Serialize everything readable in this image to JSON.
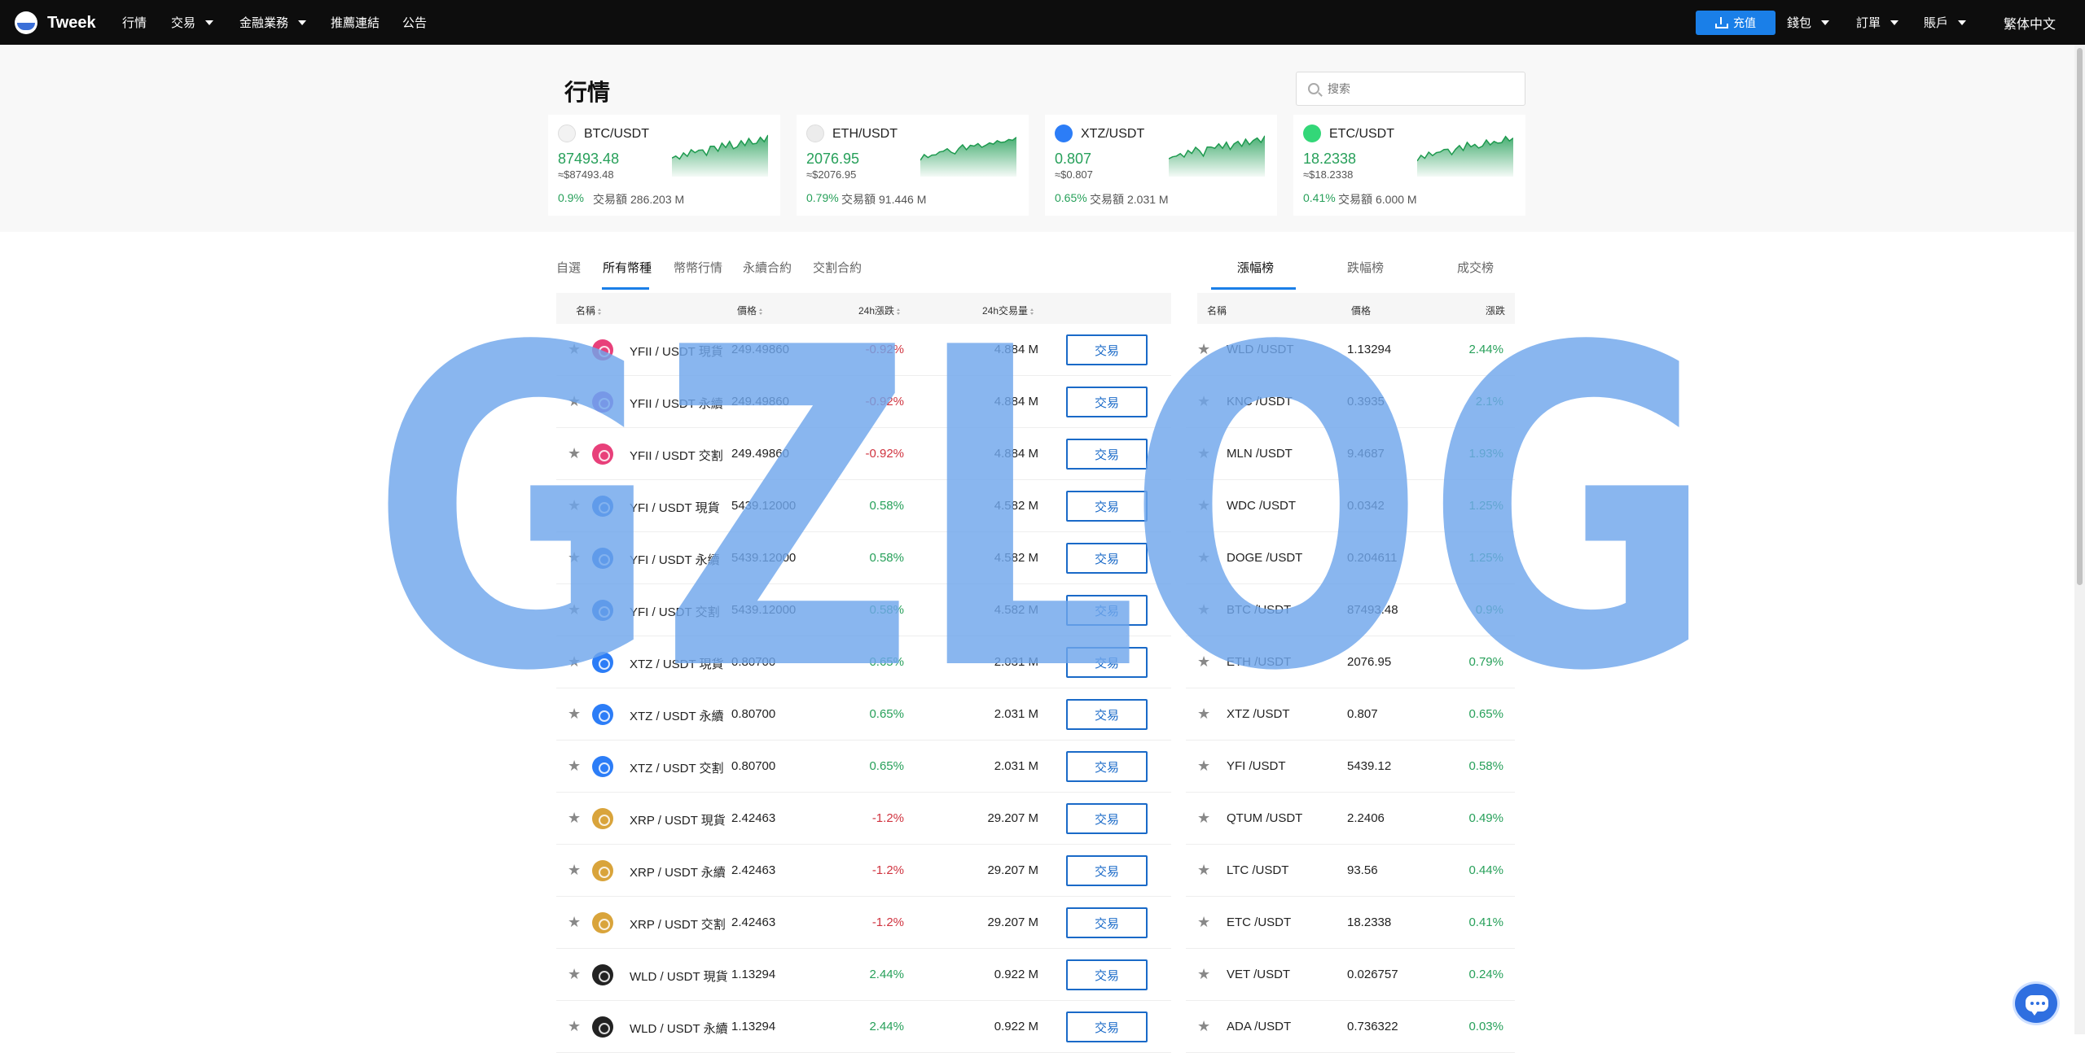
{
  "nav": {
    "logo": "Tweek",
    "items": [
      {
        "label": "行情",
        "dropdown": false
      },
      {
        "label": "交易",
        "dropdown": true
      },
      {
        "label": "金融業務",
        "dropdown": true
      },
      {
        "label": "推薦連結",
        "dropdown": false
      },
      {
        "label": "公告",
        "dropdown": false
      }
    ],
    "deposit": "充值",
    "right_items": [
      {
        "label": "錢包",
        "dropdown": true
      },
      {
        "label": "訂單",
        "dropdown": true
      },
      {
        "label": "賬戶",
        "dropdown": true
      }
    ],
    "language": "繁体中文"
  },
  "page": {
    "title": "行情",
    "search_placeholder": "搜索"
  },
  "tickers": [
    {
      "pair": "BTC/USDT",
      "price": "87493.48",
      "fiat": "≈$87493.48",
      "change": "0.9%",
      "vol_label": "交易額",
      "vol": "286.203 M",
      "icon_color": "#f2f2f2"
    },
    {
      "pair": "ETH/USDT",
      "price": "2076.95",
      "fiat": "≈$2076.95",
      "change": "0.79%",
      "vol_label": "交易額",
      "vol": "91.446 M",
      "icon_color": "#ececec"
    },
    {
      "pair": "XTZ/USDT",
      "price": "0.807",
      "fiat": "≈$0.807",
      "change": "0.65%",
      "vol_label": "交易額",
      "vol": "2.031 M",
      "icon_color": "#2c7df7"
    },
    {
      "pair": "ETC/USDT",
      "price": "18.2338",
      "fiat": "≈$18.2338",
      "change": "0.41%",
      "vol_label": "交易額",
      "vol": "6.000 M",
      "icon_color": "#33d778"
    }
  ],
  "left_tabs": [
    "自選",
    "所有幣種",
    "幣幣行情",
    "永續合約",
    "交割合約"
  ],
  "left_active_tab": 1,
  "right_tabs": [
    "漲幅榜",
    "跌幅榜",
    "成交榜"
  ],
  "right_active_tab": 0,
  "left_table": {
    "headers": [
      "名稱",
      "價格",
      "24h漲跌",
      "24h交易量"
    ],
    "trade_label": "交易",
    "rows": [
      {
        "name": "YFII / USDT 現貨",
        "price": "249.49860",
        "change": "-0.92%",
        "dir": "down",
        "volume": "4.884 M",
        "icon": "#e8407a"
      },
      {
        "name": "YFII / USDT 永續",
        "price": "249.49860",
        "change": "-0.92%",
        "dir": "down",
        "volume": "4.884 M",
        "icon": "#9a5ad0"
      },
      {
        "name": "YFII / USDT 交割",
        "price": "249.49860",
        "change": "-0.92%",
        "dir": "down",
        "volume": "4.884 M",
        "icon": "#e8407a"
      },
      {
        "name": "YFI / USDT 現貨",
        "price": "5439.12000",
        "change": "0.58%",
        "dir": "up",
        "volume": "4.582 M",
        "icon": "#1c6ce3"
      },
      {
        "name": "YFI / USDT 永續",
        "price": "5439.12000",
        "change": "0.58%",
        "dir": "up",
        "volume": "4.582 M",
        "icon": "#1c6ce3"
      },
      {
        "name": "YFI / USDT 交割",
        "price": "5439.12000",
        "change": "0.58%",
        "dir": "up",
        "volume": "4.582 M",
        "icon": "#1c6ce3"
      },
      {
        "name": "XTZ / USDT 現貨",
        "price": "0.80700",
        "change": "0.65%",
        "dir": "up",
        "volume": "2.031 M",
        "icon": "#2c7df7"
      },
      {
        "name": "XTZ / USDT 永續",
        "price": "0.80700",
        "change": "0.65%",
        "dir": "up",
        "volume": "2.031 M",
        "icon": "#2c7df7"
      },
      {
        "name": "XTZ / USDT 交割",
        "price": "0.80700",
        "change": "0.65%",
        "dir": "up",
        "volume": "2.031 M",
        "icon": "#2c7df7"
      },
      {
        "name": "XRP / USDT 現貨",
        "price": "2.42463",
        "change": "-1.2%",
        "dir": "down",
        "volume": "29.207 M",
        "icon": "#d9a43b"
      },
      {
        "name": "XRP / USDT 永續",
        "price": "2.42463",
        "change": "-1.2%",
        "dir": "down",
        "volume": "29.207 M",
        "icon": "#d9a43b"
      },
      {
        "name": "XRP / USDT 交割",
        "price": "2.42463",
        "change": "-1.2%",
        "dir": "down",
        "volume": "29.207 M",
        "icon": "#d9a43b"
      },
      {
        "name": "WLD / USDT 現貨",
        "price": "1.13294",
        "change": "2.44%",
        "dir": "up",
        "volume": "0.922 M",
        "icon": "#222222"
      },
      {
        "name": "WLD / USDT 永續",
        "price": "1.13294",
        "change": "2.44%",
        "dir": "up",
        "volume": "0.922 M",
        "icon": "#222222"
      }
    ]
  },
  "right_table": {
    "headers": [
      "名稱",
      "價格",
      "漲跌"
    ],
    "rows": [
      {
        "name": "WLD /USDT",
        "price": "1.13294",
        "change": "2.44%"
      },
      {
        "name": "KNC /USDT",
        "price": "0.3935",
        "change": "2.1%"
      },
      {
        "name": "MLN /USDT",
        "price": "9.4687",
        "change": "1.93%"
      },
      {
        "name": "WDC /USDT",
        "price": "0.0342",
        "change": "1.25%"
      },
      {
        "name": "DOGE /USDT",
        "price": "0.204611",
        "change": "1.25%"
      },
      {
        "name": "BTC /USDT",
        "price": "87493.48",
        "change": "0.9%"
      },
      {
        "name": "ETH /USDT",
        "price": "2076.95",
        "change": "0.79%"
      },
      {
        "name": "XTZ /USDT",
        "price": "0.807",
        "change": "0.65%"
      },
      {
        "name": "YFI /USDT",
        "price": "5439.12",
        "change": "0.58%"
      },
      {
        "name": "QTUM /USDT",
        "price": "2.2406",
        "change": "0.49%"
      },
      {
        "name": "LTC /USDT",
        "price": "93.56",
        "change": "0.44%"
      },
      {
        "name": "ETC /USDT",
        "price": "18.2338",
        "change": "0.41%"
      },
      {
        "name": "VET /USDT",
        "price": "0.026757",
        "change": "0.24%"
      },
      {
        "name": "ADA /USDT",
        "price": "0.736322",
        "change": "0.03%"
      }
    ]
  },
  "watermark": "GZLOG",
  "colors": {
    "up": "#27a05a",
    "down": "#d0333f",
    "accent": "#1a7fe8",
    "watermark": "#6fa6ec"
  }
}
